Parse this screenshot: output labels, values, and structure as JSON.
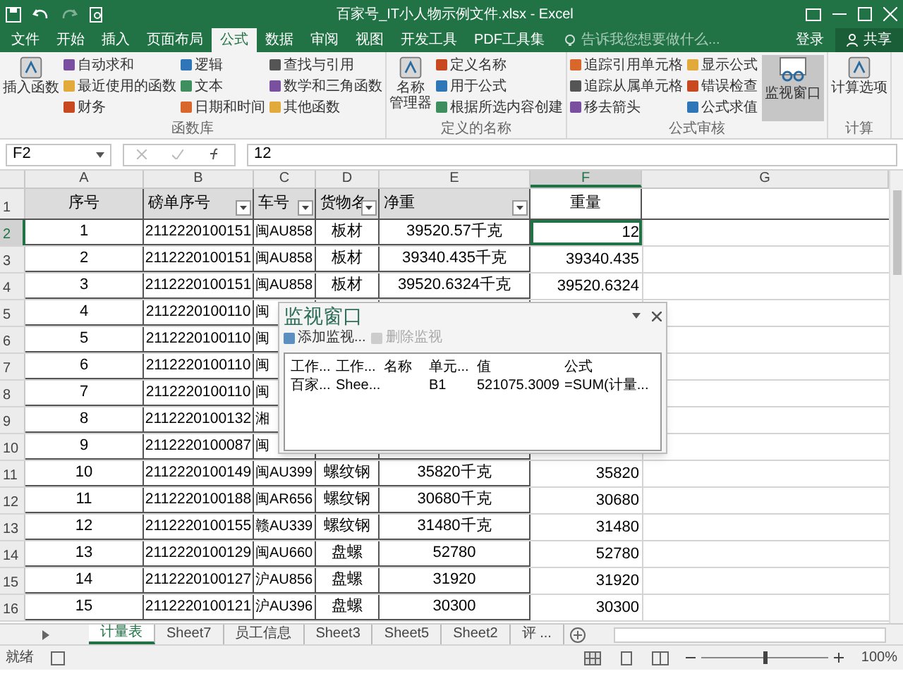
{
  "window": {
    "title": "百家号_IT小人物示例文件.xlsx - Excel"
  },
  "tabs": [
    {
      "label": "文件",
      "selected": false
    },
    {
      "label": "开始",
      "selected": false
    },
    {
      "label": "插入",
      "selected": false
    },
    {
      "label": "页面布局",
      "selected": false
    },
    {
      "label": "公式",
      "selected": true
    },
    {
      "label": "数据",
      "selected": false
    },
    {
      "label": "审阅",
      "selected": false
    },
    {
      "label": "视图",
      "selected": false
    },
    {
      "label": "开发工具",
      "selected": false
    },
    {
      "label": "PDF工具集",
      "selected": false
    }
  ],
  "search": {
    "placeholder": "告诉我您想要做什么..."
  },
  "account": {
    "login": "登录",
    "share": "共享"
  },
  "ribbon": {
    "groups": [
      {
        "name": "函数库",
        "big": [
          {
            "lines": [
              "插入函数"
            ]
          }
        ],
        "columns": [
          [
            "自动求和",
            "最近使用的函数",
            "财务"
          ],
          [
            "逻辑",
            "文本",
            "日期和时间"
          ],
          [
            "查找与引用",
            "数学和三角函数",
            "其他函数"
          ]
        ]
      },
      {
        "name": "定义的名称",
        "big": [
          {
            "lines": [
              "名称",
              "管理器"
            ]
          }
        ],
        "columns": [
          [
            "定义名称",
            "用于公式",
            "根据所选内容创建"
          ]
        ]
      },
      {
        "name": "公式审核",
        "columns": [
          [
            "追踪引用单元格",
            "追踪从属单元格",
            "移去箭头"
          ],
          [
            "显示公式",
            "错误检查",
            "公式求值"
          ]
        ],
        "trailing": [
          {
            "label": "监视窗口",
            "selected": true
          }
        ]
      },
      {
        "name": "计算",
        "big": [
          {
            "lines": [
              "计算选项"
            ]
          }
        ]
      }
    ]
  },
  "formula_bar": {
    "name_box": "F2",
    "value": "12"
  },
  "sheet": {
    "columns": [
      {
        "label": "A",
        "selected": false
      },
      {
        "label": "B",
        "selected": false
      },
      {
        "label": "C",
        "selected": false
      },
      {
        "label": "D",
        "selected": false
      },
      {
        "label": "E",
        "selected": false
      },
      {
        "label": "F",
        "selected": true
      },
      {
        "label": "G",
        "selected": false
      }
    ],
    "header_row": {
      "number": "1",
      "cells": [
        {
          "text": "序号",
          "filter": false
        },
        {
          "text": "磅单序号",
          "filter": true
        },
        {
          "text": "车号",
          "filter": true
        },
        {
          "text": "货物名",
          "filter": true
        },
        {
          "text": "净重",
          "filter": true
        },
        {
          "text": "重量",
          "filter": false
        }
      ]
    },
    "rows": [
      {
        "number": "2",
        "active": true,
        "cells": [
          "1",
          "2112220100151",
          "闽AU858",
          "板材",
          "39520.57千克",
          "12"
        ]
      },
      {
        "number": "3",
        "active": false,
        "cells": [
          "2",
          "2112220100151",
          "闽AU858",
          "板材",
          "39340.435千克",
          "39340.435"
        ]
      },
      {
        "number": "4",
        "active": false,
        "cells": [
          "3",
          "2112220100151",
          "闽AU858",
          "板材",
          "39520.6324千克",
          "39520.6324"
        ]
      },
      {
        "number": "5",
        "active": false,
        "cells": [
          "4",
          "2112220100110",
          "闽"
        ]
      },
      {
        "number": "6",
        "active": false,
        "cells": [
          "5",
          "2112220100110",
          "闽"
        ]
      },
      {
        "number": "7",
        "active": false,
        "cells": [
          "6",
          "2112220100110",
          "闽"
        ]
      },
      {
        "number": "8",
        "active": false,
        "cells": [
          "7",
          "2112220100110",
          "闽"
        ]
      },
      {
        "number": "9",
        "active": false,
        "cells": [
          "8",
          "2112220100132",
          "湘"
        ]
      },
      {
        "number": "10",
        "active": false,
        "cells": [
          "9",
          "2112220100087",
          "闽"
        ]
      },
      {
        "number": "11",
        "active": false,
        "cells": [
          "10",
          "2112220100149",
          "闽AU399",
          "螺纹钢",
          "35820千克",
          "35820"
        ]
      },
      {
        "number": "12",
        "active": false,
        "cells": [
          "11",
          "2112220100188",
          "闽AR656",
          "螺纹钢",
          "30680千克",
          "30680"
        ]
      },
      {
        "number": "13",
        "active": false,
        "cells": [
          "12",
          "2112220100155",
          "赣AU339",
          "螺纹钢",
          "31480千克",
          "31480"
        ]
      },
      {
        "number": "14",
        "active": false,
        "cells": [
          "13",
          "2112220100129",
          "闽AU660",
          "盘螺",
          "52780",
          "52780"
        ]
      },
      {
        "number": "15",
        "active": false,
        "cells": [
          "14",
          "2112220100127",
          "沪AU856",
          "盘螺",
          "31920",
          "31920"
        ]
      },
      {
        "number": "16",
        "active": false,
        "cells": [
          "15",
          "2112220100121",
          "沪AU396",
          "盘螺",
          "30300",
          "30300"
        ]
      }
    ]
  },
  "watch_window": {
    "title": "监视窗口",
    "add": {
      "label": "添加监视...",
      "disabled": false
    },
    "remove": {
      "label": "删除监视",
      "disabled": true
    },
    "columns": [
      "工作...",
      "工作...",
      "名称",
      "单元...",
      "值",
      "公式"
    ],
    "rows": [
      {
        "book": "百家...",
        "sheet": "Shee...",
        "cell": "B1",
        "value": "521075.3009",
        "formula": "=SUM(计量..."
      }
    ]
  },
  "sheet_tabs": [
    {
      "label": "计量表",
      "selected": true
    },
    {
      "label": "Sheet7",
      "selected": false
    },
    {
      "label": "员工信息",
      "selected": false
    },
    {
      "label": "Sheet3",
      "selected": false
    },
    {
      "label": "Sheet5",
      "selected": false
    },
    {
      "label": "Sheet2",
      "selected": false
    },
    {
      "label": "评 ...",
      "selected": false
    }
  ],
  "status_bar": {
    "status": "就绪",
    "zoom": "100%",
    "level": 0.5
  }
}
